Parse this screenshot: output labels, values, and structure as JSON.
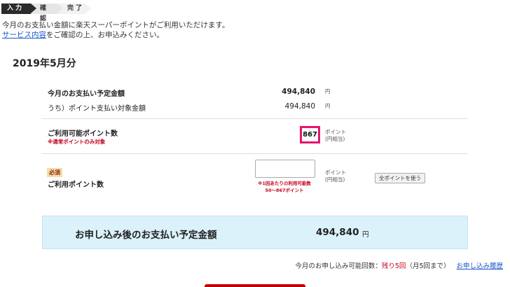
{
  "steps": [
    "入 力",
    "確 認",
    "完 了"
  ],
  "intro": {
    "line1": "今月のお支払い金額に楽天スーパーポイントがご利用いただけます。",
    "link": "サービス内容",
    "line2_rest": "をご確認の上、お申込みください。"
  },
  "month_title": "2019年5月分",
  "payment": {
    "scheduled_label": "今月のお支払い予定金額",
    "scheduled_amount": "494,840",
    "target_label": "うち）ポイント支払い対象金額",
    "target_amount": "494,840",
    "unit": "円"
  },
  "available": {
    "label": "ご利用可能ポイント数",
    "note": "※通常ポイントのみ対象",
    "points": "867",
    "unit_line1": "ポイント",
    "unit_line2": "(円相当)"
  },
  "use_points": {
    "required_badge": "必須",
    "label": "ご利用ポイント数",
    "input_value": "",
    "range_line1": "※1回あたりの利用可能数",
    "range_line2": "50～867ポイント",
    "unit_line1": "ポイント",
    "unit_line2": "(円相当)",
    "use_all_button": "全ポイントを使う"
  },
  "after_total": {
    "label": "お申し込み後のお支払い予定金額",
    "amount": "494,840",
    "unit": "円"
  },
  "footer": {
    "prefix": "今月のお申し込み可能回数：",
    "remaining": "残り5回",
    "suffix": "（月5回まで）",
    "history_link": "お申し込み履歴"
  },
  "colors": {
    "accent_pink": "#e5166b",
    "note_red": "#c4001e",
    "link_blue": "#1a55c8",
    "total_bg": "#dcf2fb",
    "brand_red": "#bf0000"
  }
}
